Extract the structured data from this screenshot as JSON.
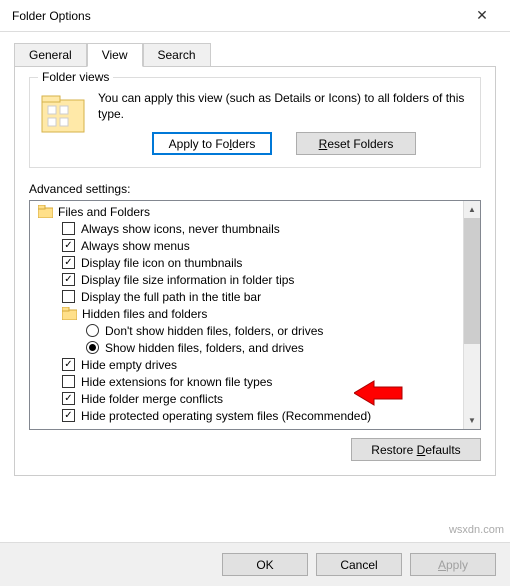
{
  "window": {
    "title": "Folder Options"
  },
  "tabs": {
    "general": "General",
    "view": "View",
    "search": "Search"
  },
  "folder_views": {
    "group_title": "Folder views",
    "text": "You can apply this view (such as Details or Icons) to all folders of this type.",
    "apply_label": "Apply to Folders",
    "reset_label": "Reset Folders"
  },
  "advanced": {
    "label": "Advanced settings:",
    "restore_label": "Restore Defaults",
    "root": "Files and Folders",
    "items": [
      {
        "label": "Always show icons, never thumbnails",
        "checked": false
      },
      {
        "label": "Always show menus",
        "checked": true
      },
      {
        "label": "Display file icon on thumbnails",
        "checked": true
      },
      {
        "label": "Display file size information in folder tips",
        "checked": true
      },
      {
        "label": "Display the full path in the title bar",
        "checked": false
      }
    ],
    "hidden_group": "Hidden files and folders",
    "radios": [
      {
        "label": "Don't show hidden files, folders, or drives",
        "selected": false
      },
      {
        "label": "Show hidden files, folders, and drives",
        "selected": true
      }
    ],
    "items2": [
      {
        "label": "Hide empty drives",
        "checked": true
      },
      {
        "label": "Hide extensions for known file types",
        "checked": false
      },
      {
        "label": "Hide folder merge conflicts",
        "checked": true
      },
      {
        "label": "Hide protected operating system files (Recommended)",
        "checked": true
      }
    ]
  },
  "footer": {
    "ok": "OK",
    "cancel": "Cancel",
    "apply": "Apply"
  },
  "watermark": "wsxdn.com"
}
